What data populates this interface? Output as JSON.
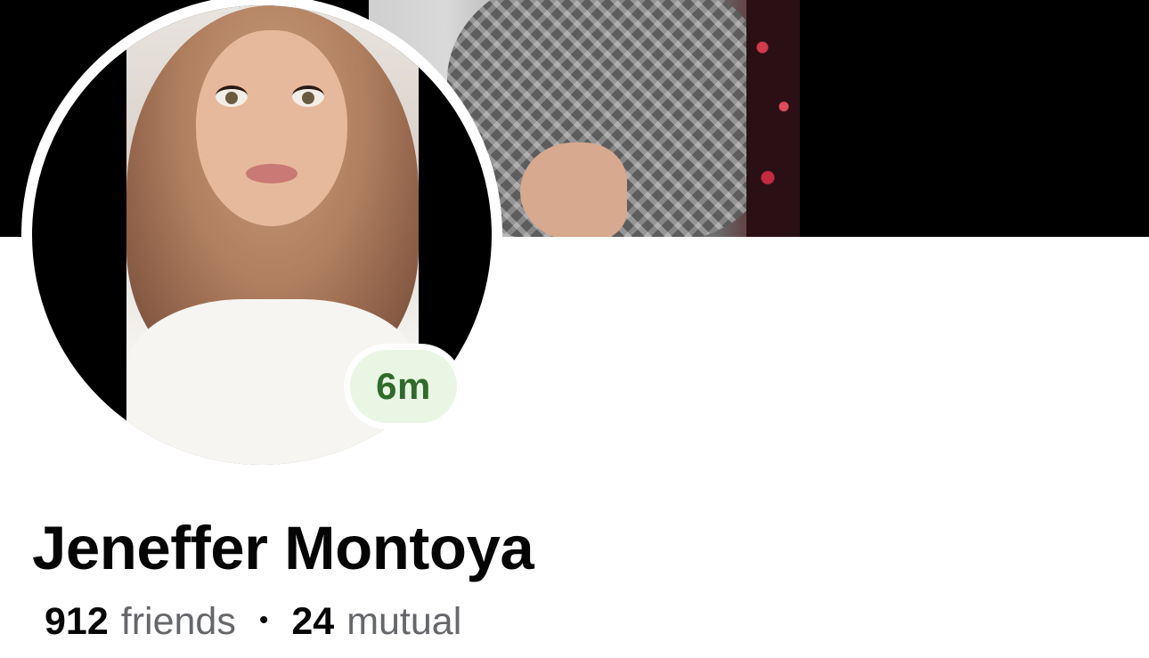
{
  "profile": {
    "name": "Jeneffer Montoya",
    "active_badge": "6m",
    "friends_count": "912",
    "friends_label": "friends",
    "separator": "•",
    "mutual_count": "24",
    "mutual_label": "mutual"
  },
  "colors": {
    "badge_background": "#e9f6e3",
    "badge_text": "#2f6b2a",
    "name_text": "#050505",
    "secondary_text": "#65676b",
    "cover_background": "#000000"
  }
}
